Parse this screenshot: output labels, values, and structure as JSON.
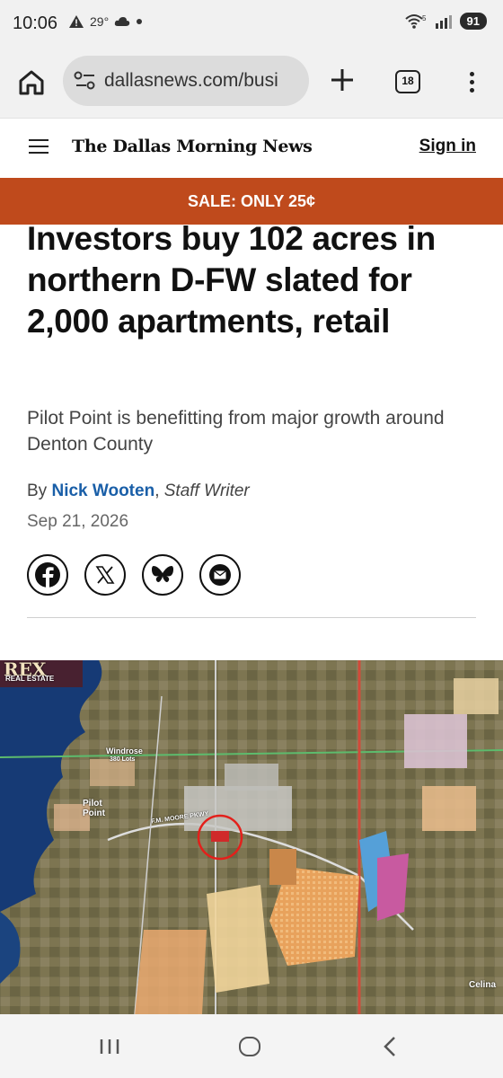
{
  "status_bar": {
    "time": "10:06",
    "temperature": "29°",
    "battery": "91",
    "signal_label": "5"
  },
  "browser": {
    "url": "dallasnews.com/busi",
    "tab_count": "18"
  },
  "site": {
    "logo": "The Dallas Morning News",
    "sign_in": "Sign in"
  },
  "banner": {
    "text": "SALE: ONLY 25¢"
  },
  "article": {
    "headline": "Investors buy 102 acres in northern D-FW slated for 2,000 apartments, retail",
    "dek": "Pilot Point is benefitting from major growth around Denton County",
    "byline_prefix": "By",
    "author": "Nick Wooten",
    "role": "Staff Writer",
    "date": "Sep 21, 2026"
  },
  "share": [
    {
      "name": "facebook-icon"
    },
    {
      "name": "x-icon"
    },
    {
      "name": "bluesky-icon"
    },
    {
      "name": "email-icon"
    }
  ],
  "map": {
    "brand": "REX",
    "brand_sub": "REAL ESTATE",
    "labels": {
      "windrose": "Windrose",
      "windrose_lots": "380 Lots",
      "pilot_point": "Pilot Point",
      "road": "F.M. MOORE PKWY",
      "celina": "Celina"
    }
  },
  "colors": {
    "banner": "#bf4a1c",
    "author": "#1a5fa8"
  }
}
